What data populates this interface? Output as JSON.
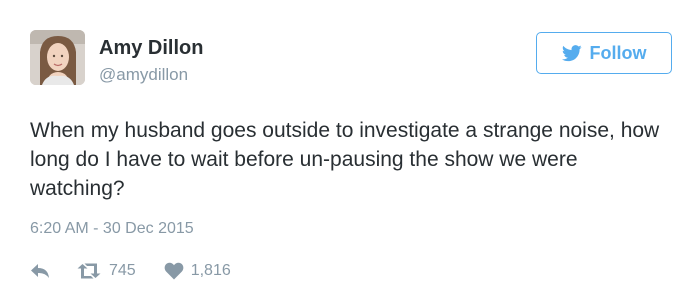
{
  "user": {
    "display_name": "Amy Dillon",
    "handle": "@amydillon"
  },
  "follow_button": {
    "label": "Follow",
    "icon": "twitter-bird-icon"
  },
  "tweet": {
    "text": "When my husband goes outside to investigate a strange noise, how long do I have to wait before un-pausing the show we were watching?",
    "timestamp": "6:20 AM - 30 Dec 2015"
  },
  "actions": {
    "reply_icon": "reply-icon",
    "retweet_icon": "retweet-icon",
    "retweet_count": "745",
    "like_icon": "heart-icon",
    "like_count": "1,816"
  },
  "colors": {
    "accent": "#55acee",
    "text": "#292f33",
    "muted": "#8899a6"
  }
}
